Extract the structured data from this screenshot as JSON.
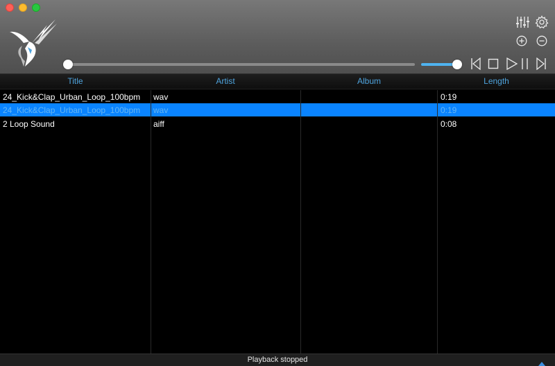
{
  "window": {
    "controls": [
      "close",
      "minimize",
      "maximize"
    ]
  },
  "toolbar": {
    "icons": {
      "logo": "hummingbird-logo",
      "equalizer": "equalizer-icon",
      "settings": "gear-icon",
      "add": "plus-circle-icon",
      "remove": "minus-circle-icon",
      "previous": "previous-track-icon",
      "stop": "stop-icon",
      "play_pause": "play-pause-icon",
      "next": "next-track-icon"
    },
    "seek_progress": 0.0,
    "volume_level": 1.0
  },
  "colors": {
    "accent": "#4ea3dd",
    "selection": "#0a84ff",
    "selected_text": "#66b6f2",
    "volume_fill": "#4fb3f0"
  },
  "columns": {
    "title": "Title",
    "artist": "Artist",
    "album": "Album",
    "length": "Length"
  },
  "tracks": [
    {
      "title": "24_Kick&Clap_Urban_Loop_100bpm",
      "artist": "wav",
      "album": "",
      "length": "0:19",
      "selected": false
    },
    {
      "title": "24_Kick&Clap_Urban_Loop_100bpm",
      "artist": "wav",
      "album": "",
      "length": "0:19",
      "selected": true
    },
    {
      "title": "2 Loop Sound",
      "artist": "aiff",
      "album": "",
      "length": "0:08",
      "selected": false
    }
  ],
  "status": {
    "text": "Playback stopped",
    "toggle_icon": "triangle-up-icon"
  }
}
